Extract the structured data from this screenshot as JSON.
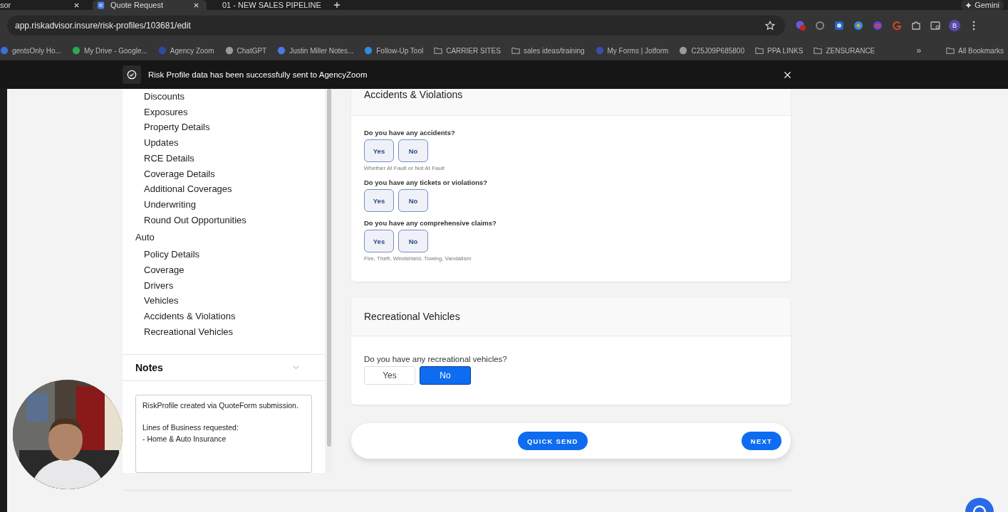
{
  "browser": {
    "tabs": [
      {
        "title": "sor",
        "selected": false
      },
      {
        "title": "Quote Request",
        "selected": true
      },
      {
        "title": "01 - NEW SALES PIPELINE",
        "selected": false
      }
    ],
    "gemini": "Gemini",
    "url": "app.riskadvisor.insure/risk-profiles/103681/edit",
    "profile": "B",
    "bookmarks": [
      {
        "label": "gentsOnly Ho...",
        "kind": "site",
        "color": "#3b6fd8"
      },
      {
        "label": "My Drive - Google...",
        "kind": "site",
        "color": "#2fa84f"
      },
      {
        "label": "Agency Zoom",
        "kind": "site",
        "color": "#2a4fa0"
      },
      {
        "label": "ChatGPT",
        "kind": "site",
        "color": "#9a9a9a"
      },
      {
        "label": "Justin Miller Notes...",
        "kind": "site",
        "color": "#4a78e0"
      },
      {
        "label": "Follow-Up Tool",
        "kind": "site",
        "color": "#2f8ae0"
      },
      {
        "label": "CARRIER SITES",
        "kind": "folder"
      },
      {
        "label": "sales ideas/training",
        "kind": "folder"
      },
      {
        "label": "My Forms | Jotform",
        "kind": "site",
        "color": "#3b4fa8"
      },
      {
        "label": "C25J09P685800",
        "kind": "site",
        "color": "#9a9a9a"
      },
      {
        "label": "PPA LINKS",
        "kind": "folder"
      },
      {
        "label": "ZENSURANCE",
        "kind": "folder"
      }
    ],
    "more": "»",
    "all_bookmarks": "All Bookmarks"
  },
  "toast": {
    "message": "Risk Profile data has been successfully sent to AgencyZoom"
  },
  "sidebar": {
    "sections": [
      {
        "children": [
          {
            "label": "Discounts"
          },
          {
            "label": "Exposures"
          },
          {
            "label": "Property Details"
          },
          {
            "label": "Updates"
          },
          {
            "label": "RCE Details"
          },
          {
            "label": "Coverage Details"
          },
          {
            "label": "Additional Coverages"
          },
          {
            "label": "Underwriting"
          },
          {
            "label": "Round Out Opportunities"
          }
        ]
      },
      {
        "label": "Auto",
        "children": [
          {
            "label": "Policy Details"
          },
          {
            "label": "Coverage"
          },
          {
            "label": "Drivers"
          },
          {
            "label": "Vehicles"
          },
          {
            "label": "Accidents & Violations"
          },
          {
            "label": "Recreational Vehicles"
          }
        ]
      }
    ],
    "notes": {
      "title": "Notes",
      "expanded": false,
      "value": "RiskProfile created via QuoteForm submission.\n\nLines of Business requested:\n- Home & Auto Insurance"
    }
  },
  "cards": [
    {
      "title": "Accidents & Violations",
      "questions": [
        {
          "kind": "boxed",
          "label": "Do you have any accidents?",
          "options": [
            {
              "label": "Yes",
              "selected": false
            },
            {
              "label": "No",
              "selected": false
            }
          ],
          "hint": "Whether At Fault or Not At Fault"
        },
        {
          "kind": "boxed",
          "label": "Do you have any tickets or violations?",
          "options": [
            {
              "label": "Yes",
              "selected": false
            },
            {
              "label": "No",
              "selected": false
            }
          ]
        },
        {
          "kind": "boxed",
          "label": "Do you have any comprehensive claims?",
          "options": [
            {
              "label": "Yes",
              "selected": false
            },
            {
              "label": "No",
              "selected": false
            }
          ],
          "hint": "Fire, Theft, Windshield, Towing, Vandalism"
        }
      ]
    },
    {
      "title": "Recreational Vehicles",
      "questions": [
        {
          "kind": "segmented",
          "label": "Do you have any recreational vehicles?",
          "options": [
            {
              "label": "Yes",
              "selected": false
            },
            {
              "label": "No",
              "selected": true
            }
          ]
        }
      ]
    }
  ],
  "actions": {
    "quick_send": "QUICK SEND",
    "next": "NEXT"
  }
}
